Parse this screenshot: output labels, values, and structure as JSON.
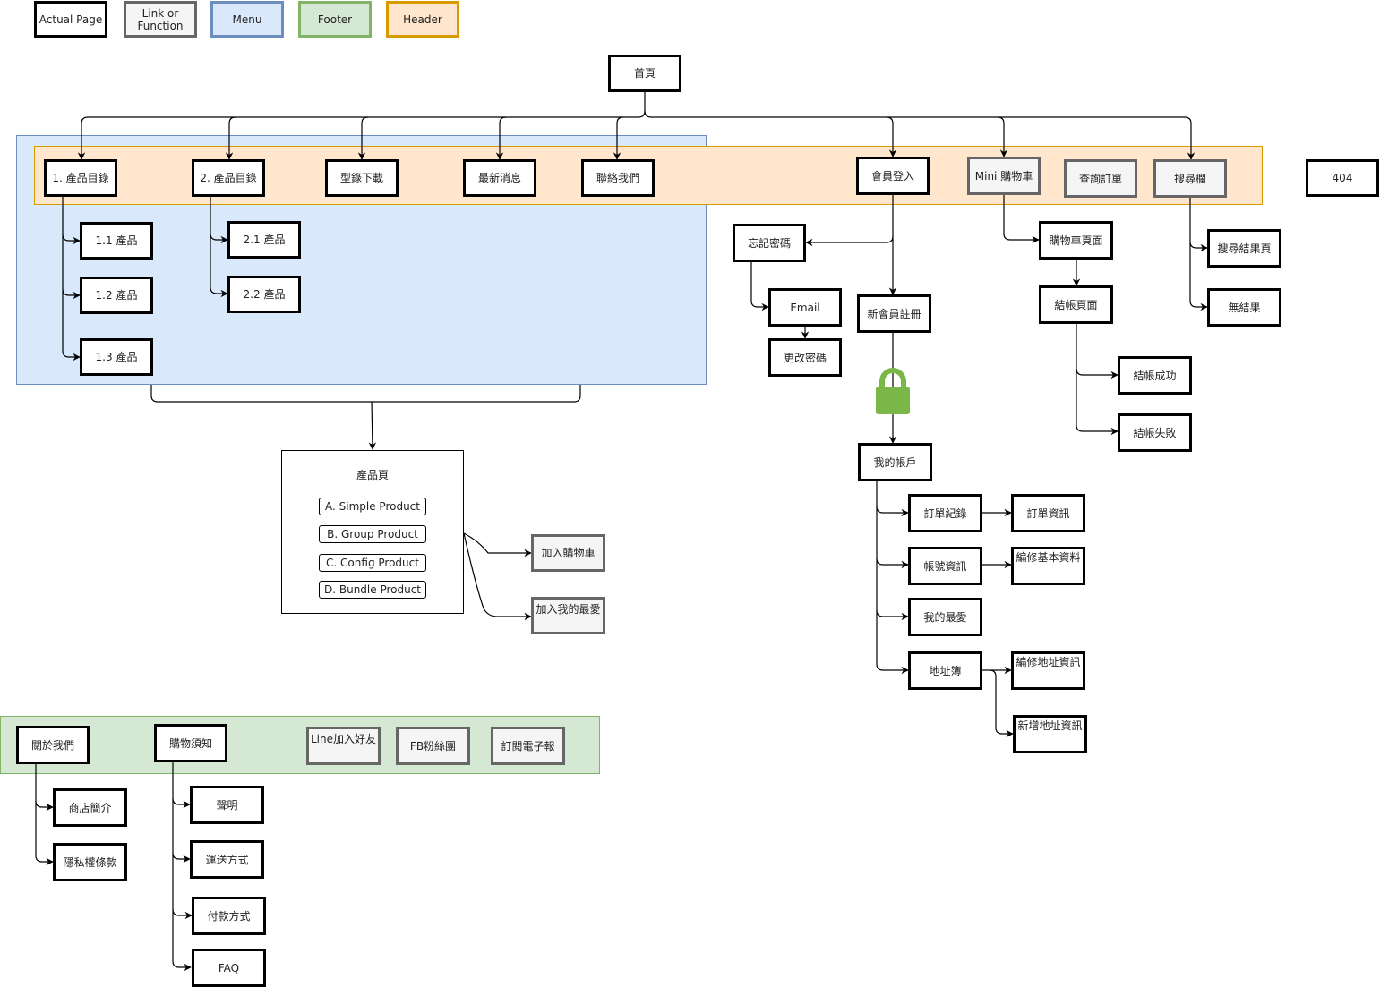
{
  "legend": {
    "actual_page": "Actual Page",
    "link_or_function": "Link or\nFunction",
    "menu": "Menu",
    "footer": "Footer",
    "header": "Header"
  },
  "colors": {
    "menu_fill": "#dae8fc",
    "menu_border": "#6c8ebf",
    "header_fill": "#ffe6cc",
    "header_border": "#d79b00",
    "footer_fill": "#d5e8d4",
    "footer_border": "#82b366",
    "link_fill": "#f5f5f5",
    "link_border": "#666666",
    "lock": "#7ab648"
  },
  "home": "首頁",
  "header_items": {
    "catalog1": "1. 產品目錄",
    "catalog2": "2. 產品目錄",
    "catalog_download": "型錄下載",
    "news": "最新消息",
    "contact": "聯絡我們",
    "member_login": "會員登入",
    "mini_cart": "Mini 購物車",
    "order_query": "查詢訂單",
    "search_bar": "搜尋欄"
  },
  "not_found": "404",
  "menu_items": {
    "p11": "1.1 產品",
    "p12": "1.2 產品",
    "p13": "1.3 產品",
    "p21": "2.1 產品",
    "p22": "2.2 產品"
  },
  "product_page": {
    "title": "產品頁",
    "variants": [
      "A. Simple Product",
      "B. Group Product",
      "C. Config Product",
      "D. Bundle Product"
    ],
    "add_to_cart": "加入購物車",
    "add_to_favorites": "加入我的最愛"
  },
  "member": {
    "forgot_password": "忘記密碼",
    "email": "Email",
    "change_password": "更改密碼",
    "register": "新會員註冊",
    "lock_icon": "lock-icon",
    "my_account": "我的帳戶",
    "order_history": "訂單紀錄",
    "order_info": "訂單資訊",
    "account_info": "帳號資訊",
    "edit_basic_info": "編修基本資料",
    "my_favorites": "我的最愛",
    "address_book": "地址簿",
    "edit_address": "編修地址資訊",
    "add_address": "新增地址資訊"
  },
  "cart": {
    "cart_page": "購物車頁面",
    "checkout_page": "結帳頁面",
    "checkout_success": "結帳成功",
    "checkout_failure": "結帳失敗"
  },
  "search": {
    "results_page": "搜尋結果頁",
    "no_results": "無結果"
  },
  "footer_items": {
    "about_us": "關於我們",
    "shopping_guide": "購物須知",
    "line_add_friend": "Line加入好友",
    "fb_fans": "FB粉絲團",
    "newsletter": "訂閱電子報"
  },
  "about": {
    "store_intro": "商店簡介",
    "privacy": "隱私權條款"
  },
  "guide": {
    "statement": "聲明",
    "shipping": "運送方式",
    "payment": "付款方式",
    "faq": "FAQ"
  }
}
